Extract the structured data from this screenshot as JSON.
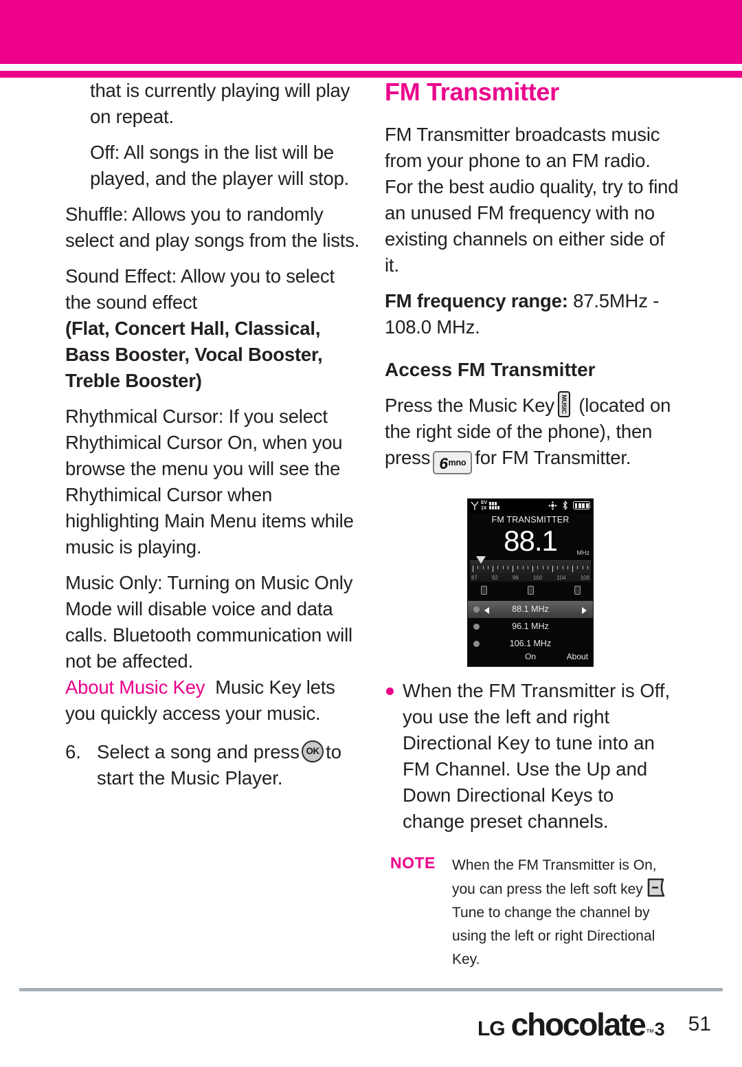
{
  "colors": {
    "brand_pink": "#ec008c",
    "body_text": "#231f20",
    "footer_rule": "#a6b0b7"
  },
  "left_column": {
    "para_repeat": "that is currently playing will play on repeat.",
    "para_off": "Off: All songs in the list will be played, and the player will stop.",
    "para_shuffle": "Shuffle: Allows you to randomly select and play songs from the lists.",
    "para_sound_effect": "Sound Effect: Allow you to select the sound effect",
    "sound_effect_options": "(Flat, Concert Hall, Classical, Bass Booster, Vocal Booster, Treble Booster)",
    "para_rhythmical": "Rhythmical Cursor: If you select Rhythimical Cursor On, when you browse the menu you will see the Rhythimical Cursor when highlighting Main Menu items while music is playing.",
    "para_music_only": "Music Only: Turning on Music Only Mode will disable voice and data calls. Bluetooth communication will not be affected.",
    "about_music_key_label": "About Music Key",
    "about_music_key_text": "Music Key lets you quickly access your music.",
    "step": {
      "number": "6.",
      "text_before": "Select a song and press",
      "key_label": "OK",
      "text_after": "to start the Music Player."
    }
  },
  "right_column": {
    "heading": "FM Transmitter",
    "intro": "FM Transmitter broadcasts music from your phone to an FM radio. For the best audio quality, try to find an unused FM frequency with no existing channels on either side of it.",
    "freq_range_label": "FM frequency range:",
    "freq_range_value": "87.5MHz - 108.0 MHz.",
    "access_heading": "Access FM Transmitter",
    "access_text_1": "Press the Music Key",
    "music_key_label": "MUSIC",
    "access_text_2": "(located on the right side of the phone), then press",
    "num_key_digit": "6",
    "num_key_letters": "mno",
    "access_text_3": "for FM Transmitter.",
    "bullet": "When the FM Transmitter is Off, you use the left and right Directional Key to tune into an FM Channel. Use the Up and Down Directional Keys to change preset channels."
  },
  "phone_screen": {
    "status": {
      "antenna_icon": "antenna-icon",
      "network_line1": "EV",
      "network_line2": "1X",
      "gps_icon": "gps-icon",
      "bluetooth_icon": "bluetooth-icon",
      "battery_icon": "battery-icon"
    },
    "title": "FM TRANSMITTER",
    "frequency": "88.1",
    "unit": "MHz",
    "scale_labels": [
      "87",
      "92",
      "96",
      "100",
      "104",
      "108"
    ],
    "presets": [
      {
        "value": "88.1 MHz",
        "selected": true
      },
      {
        "value": "96.1 MHz",
        "selected": false
      },
      {
        "value": "106.1 MHz",
        "selected": false
      }
    ],
    "softkey_left": "On",
    "softkey_right": "About"
  },
  "note": {
    "label": "NOTE",
    "text_1": "When the FM Transmitter is On, you can press the left soft key",
    "soft_key_icon": "soft-key-icon",
    "text_2": "Tune to change the channel by using the left or right Directional Key."
  },
  "footer": {
    "brand_lg": "LG",
    "brand_name": "chocolate",
    "brand_tm": "™",
    "brand_version": "3",
    "page_number": "51"
  }
}
